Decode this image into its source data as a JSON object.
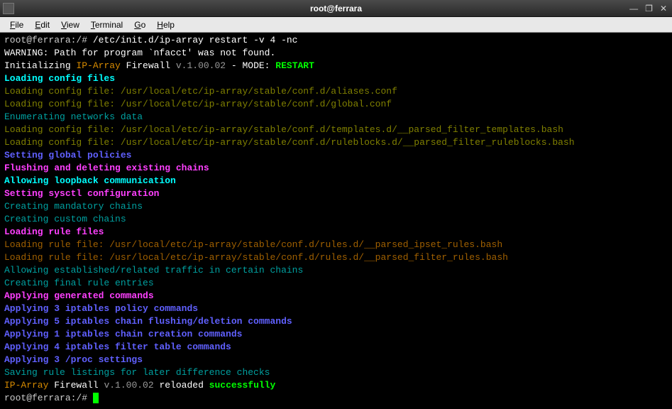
{
  "window": {
    "title": "root@ferrara",
    "controls": {
      "min": "—",
      "max": "❐",
      "close": "✕"
    }
  },
  "menu": {
    "file": "File",
    "edit": "Edit",
    "view": "View",
    "terminal": "Terminal",
    "go": "Go",
    "help": "Help"
  },
  "term": {
    "prompt1": "root@ferrara:/# ",
    "cmd": "/etc/init.d/ip-array restart -v 4 -nc",
    "warn": "WARNING: Path for program `nfacct' was not found.",
    "init1": "Initializing ",
    "init2": "IP-Array ",
    "init3": "Firewall ",
    "init4": "v.1.00.02",
    "init5": " - MODE: ",
    "init6": "RESTART",
    "load_cfg": "Loading config files",
    "cfg1": "Loading config file: /usr/local/etc/ip-array/stable/conf.d/aliases.conf",
    "cfg2": "Loading config file: /usr/local/etc/ip-array/stable/conf.d/global.conf",
    "enum": "Enumerating networks data",
    "cfg3": "Loading config file: /usr/local/etc/ip-array/stable/conf.d/templates.d/__parsed_filter_templates.bash",
    "cfg4": "Loading config file: /usr/local/etc/ip-array/stable/conf.d/ruleblocks.d/__parsed_filter_ruleblocks.bash",
    "setpol": "Setting global policies",
    "flush": "Flushing and deleting existing chains",
    "loop": "Allowing loopback communication",
    "sysctl": "Setting sysctl configuration",
    "cmand": "Creating mandatory chains",
    "ccust": "Creating custom chains",
    "lrules": "Loading rule files",
    "rule1": "Loading rule file: /usr/local/etc/ip-array/stable/conf.d/rules.d/__parsed_ipset_rules.bash",
    "rule2": "Loading rule file: /usr/local/etc/ip-array/stable/conf.d/rules.d/__parsed_filter_rules.bash",
    "allow": "Allowing established/related traffic in certain chains",
    "cfinal": "Creating final rule entries",
    "applygen": "Applying generated commands",
    "apply1": "Applying 3 iptables policy commands",
    "apply2": "Applying 5 iptables chain flushing/deletion commands",
    "apply3": "Applying 1 iptables chain creation commands",
    "apply4": "Applying 4 iptables filter table commands",
    "apply5": "Applying 3 /proc settings",
    "saving": "Saving rule listings for later difference checks",
    "done1": "IP-Array ",
    "done2": "Firewall ",
    "done3": "v.1.00.02",
    "done4": " reloaded ",
    "done5": "successfully",
    "prompt2": "root@ferrara:/# "
  }
}
